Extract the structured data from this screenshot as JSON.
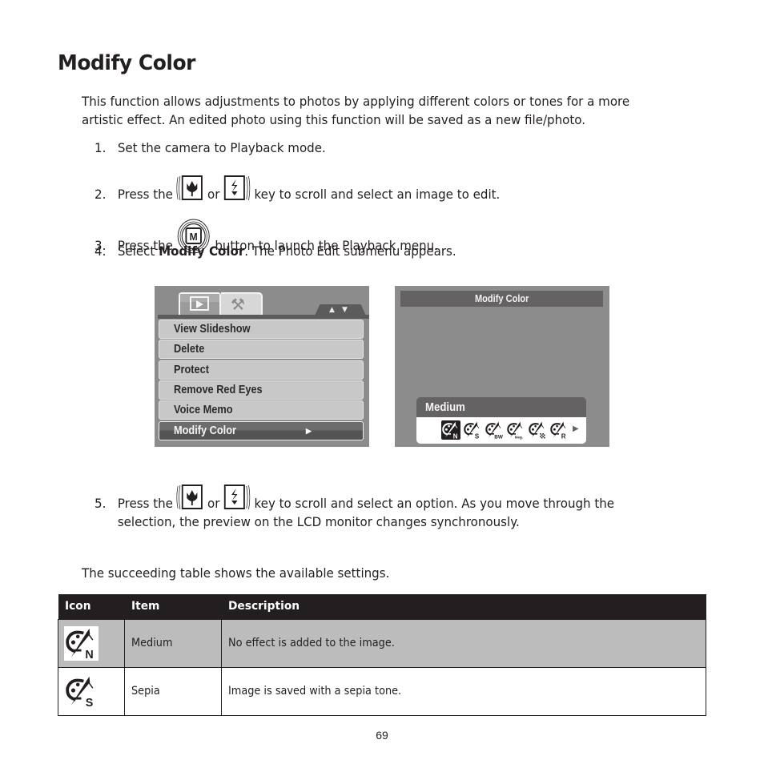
{
  "title": "Modify Color",
  "intro": [
    "This function allows adjustments to photos by applying different colors or tones for a more",
    "artistic effect. An edited photo using this function will be saved as a new file/photo."
  ],
  "steps": [
    {
      "num": "1.",
      "text": "Set the camera to Playback mode."
    },
    {
      "num": "2.",
      "pre": "Press the",
      "mid": "or",
      "post": "key to scroll and select an image to edit.",
      "icons": [
        "macro-key-icon",
        "flash-key-icon"
      ]
    },
    {
      "num": "3.",
      "pre": "Press the",
      "post": "button to launch the Playback menu.",
      "icons": [
        "menu-m-button-icon"
      ]
    },
    {
      "num": "4.",
      "pre": "Select",
      "bold": "Modify Color",
      "post": ". The Photo Edit submenu appears."
    },
    {
      "num": "5.",
      "pre": "Press the",
      "mid": "or",
      "post": "key to scroll and select an option. As you move through the",
      "cont": "selection, the preview on the LCD monitor changes synchronously.",
      "icons": [
        "macro-key-icon",
        "flash-key-icon"
      ]
    }
  ],
  "lcd_menu": {
    "tabs": [
      "playback-tab",
      "setup-tab"
    ],
    "scroll": {
      "up": "▲",
      "down": "▼"
    },
    "items": [
      "View Slideshow",
      "Delete",
      "Protect",
      "Remove Red Eyes",
      "Voice Memo",
      "Modify Color"
    ],
    "selected": "Modify Color",
    "selected_arrow": "▶"
  },
  "lcd_modify": {
    "header": "Modify Color",
    "current_option": "Medium",
    "options": [
      {
        "icon": "medium-color-icon",
        "letter": "N",
        "selected": true
      },
      {
        "icon": "sepia-icon",
        "letter": "S",
        "selected": false
      },
      {
        "icon": "black-white-icon",
        "letter": "BW",
        "selected": false
      },
      {
        "icon": "negative-icon",
        "letter": "Neg.",
        "selected": false
      },
      {
        "icon": "mosaic-icon",
        "letter": "",
        "selected": false
      },
      {
        "icon": "red-icon",
        "letter": "R",
        "selected": false
      }
    ],
    "next_arrow": "▶"
  },
  "table_intro": "The succeeding table shows the available settings.",
  "table": {
    "headers": [
      "Icon",
      "Item",
      "Description"
    ],
    "rows": [
      {
        "icon": "medium-color-icon",
        "letter": "N",
        "item": "Medium",
        "description": "No effect is added to the image.",
        "shaded": true
      },
      {
        "icon": "sepia-icon",
        "letter": "S",
        "item": "Sepia",
        "description": "Image is saved with a sepia tone.",
        "shaded": false
      }
    ]
  },
  "page_number": "69"
}
